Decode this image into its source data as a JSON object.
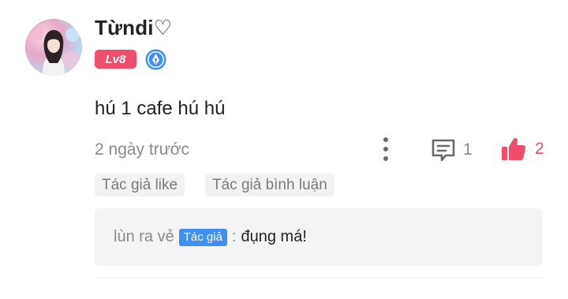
{
  "comment": {
    "username": "Từndi♡",
    "level_badge": "Lv8",
    "text": "hú 1 cafe hú hú",
    "timestamp": "2 ngày trước",
    "reply_count": "1",
    "like_count": "2",
    "tags": [
      "Tác giả like",
      "Tác giả bình luận"
    ],
    "reply": {
      "author": "lùn ra vẻ",
      "author_badge": "Tác giả",
      "separator": ":",
      "text": "đụng má!"
    }
  },
  "colors": {
    "accent_red": "#ef4d6b",
    "author_blue": "#3f8ef2",
    "muted_text": "#8a8a8a",
    "tag_bg": "#f2f2f4"
  },
  "icons": {
    "pen": "pen-nib-icon",
    "more": "more-vertical-icon",
    "reply": "comment-icon",
    "like": "thumbs-up-icon"
  }
}
